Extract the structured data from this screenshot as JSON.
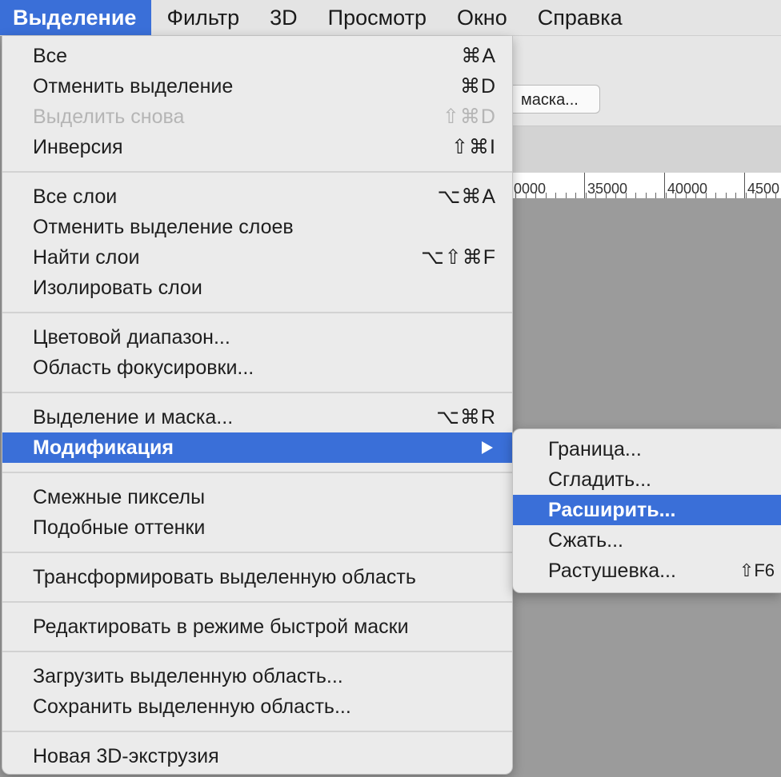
{
  "menubar": {
    "items": [
      "Выделение",
      "Фильтр",
      "3D",
      "Просмотр",
      "Окно",
      "Справка"
    ],
    "active_index": 0
  },
  "background": {
    "mask_button_label": "маска...",
    "ruler_labels": [
      "0000",
      "35000",
      "40000",
      "4500"
    ]
  },
  "menu": {
    "items": [
      {
        "label": "Все",
        "shortcut": "⌘A"
      },
      {
        "label": "Отменить выделение",
        "shortcut": "⌘D"
      },
      {
        "label": "Выделить снова",
        "shortcut": "⇧⌘D",
        "disabled": true
      },
      {
        "label": "Инверсия",
        "shortcut": "⇧⌘I"
      },
      {
        "label": "Все слои",
        "shortcut": "⌥⌘A"
      },
      {
        "label": "Отменить выделение слоев",
        "shortcut": ""
      },
      {
        "label": "Найти слои",
        "shortcut": "⌥⇧⌘F"
      },
      {
        "label": "Изолировать слои",
        "shortcut": ""
      },
      {
        "label": "Цветовой диапазон...",
        "shortcut": ""
      },
      {
        "label": "Область фокусировки...",
        "shortcut": ""
      },
      {
        "label": "Выделение и маска...",
        "shortcut": "⌥⌘R"
      },
      {
        "label": "Модификация",
        "shortcut": "",
        "highlight": true,
        "submenu": true
      },
      {
        "label": "Смежные пикселы",
        "shortcut": ""
      },
      {
        "label": "Подобные оттенки",
        "shortcut": ""
      },
      {
        "label": "Трансформировать выделенную область",
        "shortcut": ""
      },
      {
        "label": "Редактировать в режиме быстрой маски",
        "shortcut": ""
      },
      {
        "label": "Загрузить выделенную область...",
        "shortcut": ""
      },
      {
        "label": "Сохранить выделенную область...",
        "shortcut": ""
      },
      {
        "label": "Новая 3D-экструзия",
        "shortcut": ""
      }
    ]
  },
  "submenu": {
    "items": [
      {
        "label": "Граница...",
        "shortcut": ""
      },
      {
        "label": "Сгладить...",
        "shortcut": ""
      },
      {
        "label": "Расширить...",
        "shortcut": "",
        "highlight": true
      },
      {
        "label": "Сжать...",
        "shortcut": ""
      },
      {
        "label": "Растушевка...",
        "shortcut": "⇧F6"
      }
    ]
  },
  "colors": {
    "highlight": "#3a6fd8",
    "menu_bg": "#ebebeb",
    "disabled_text": "#b5b5b5",
    "canvas_bg": "#9b9b9b"
  }
}
